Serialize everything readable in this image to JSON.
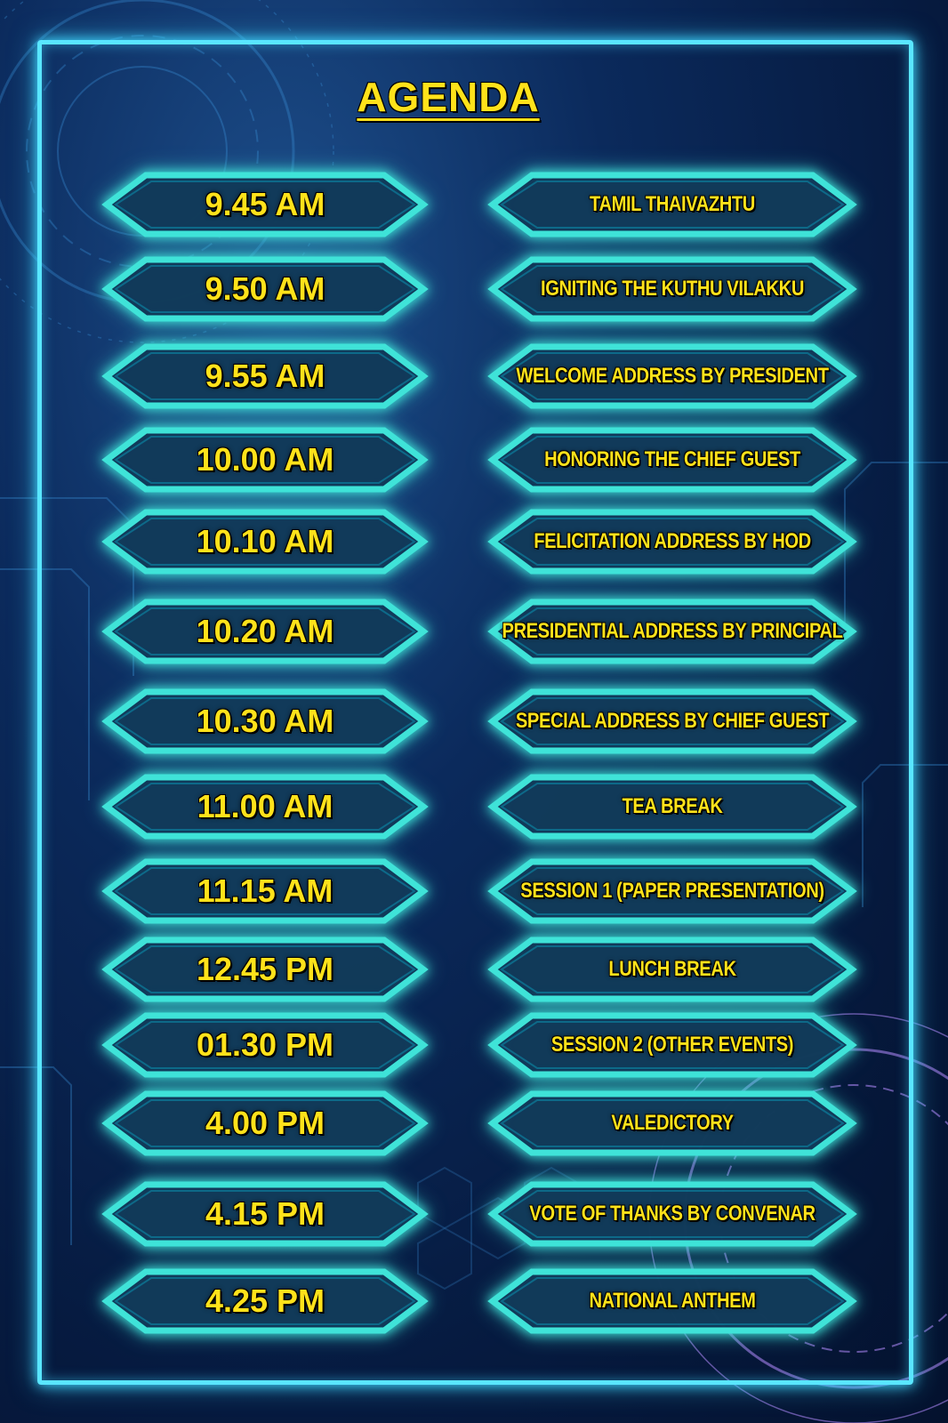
{
  "title": "AGENDA",
  "colors": {
    "accent": "#ffe21a",
    "frame": "#59e6ff",
    "background": "#0b2a5c"
  },
  "agenda": [
    {
      "time": "9.45 AM",
      "event": "TAMIL THAIVAZHTU"
    },
    {
      "time": "9.50 AM",
      "event": "IGNITING THE KUTHU VILAKKU"
    },
    {
      "time": "9.55 AM",
      "event": "WELCOME ADDRESS BY PRESIDENT"
    },
    {
      "time": "10.00 AM",
      "event": "HONORING THE CHIEF GUEST"
    },
    {
      "time": "10.10 AM",
      "event": "FELICITATION ADDRESS BY HOD"
    },
    {
      "time": "10.20 AM",
      "event": "PRESIDENTIAL ADDRESS BY PRINCIPAL"
    },
    {
      "time": "10.30 AM",
      "event": "SPECIAL  ADDRESS BY CHIEF GUEST"
    },
    {
      "time": "11.00 AM",
      "event": "TEA BREAK"
    },
    {
      "time": "11.15 AM",
      "event": "SESSION 1 (PAPER PRESENTATION)"
    },
    {
      "time": "12.45 PM",
      "event": "LUNCH BREAK"
    },
    {
      "time": "01.30 PM",
      "event": "SESSION 2 (OTHER EVENTS)"
    },
    {
      "time": "4.00 PM",
      "event": "VALEDICTORY"
    },
    {
      "time": "4.15 PM",
      "event": "VOTE OF THANKS BY CONVENAR"
    },
    {
      "time": "4.25 PM",
      "event": "NATIONAL ANTHEM"
    }
  ]
}
